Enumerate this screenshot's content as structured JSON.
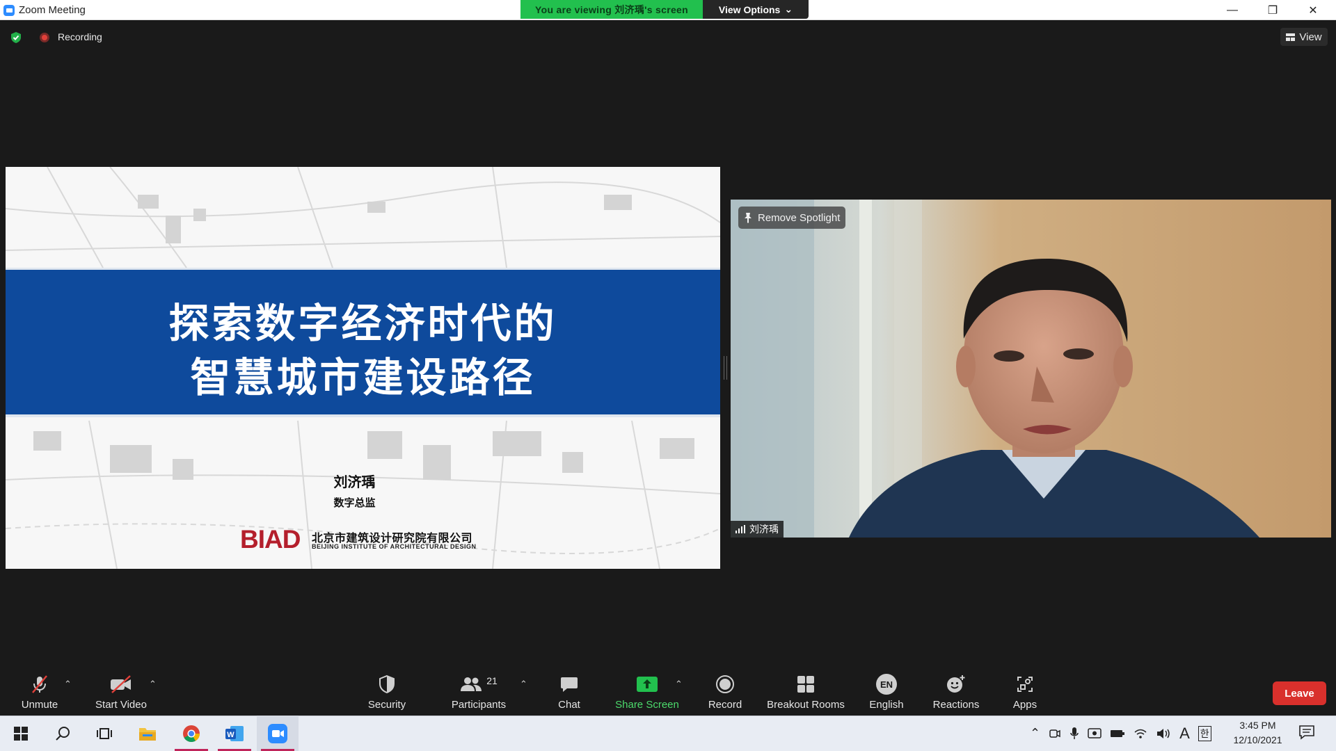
{
  "window": {
    "title": "Zoom Meeting",
    "viewing_banner": "You are viewing 刘济瑀's screen",
    "view_options": "View Options",
    "minimize": "—",
    "restore": "❐",
    "close": "✕"
  },
  "meeting_bar": {
    "recording": "Recording",
    "view": "View"
  },
  "shared_screen": {
    "title_line1": "探索数字经济时代的",
    "title_line2": "智慧城市建设路径",
    "presenter": "刘济瑀",
    "role": "数字总监",
    "logo": "BIAD",
    "org_cn": "北京市建筑设计研究院有限公司",
    "org_en": "BEIJING INSTITUTE OF ARCHITECTURAL DESIGN"
  },
  "video": {
    "remove_spotlight": "Remove Spotlight",
    "participant_name": "刘济瑀"
  },
  "toolbar": {
    "unmute": "Unmute",
    "start_video": "Start Video",
    "security": "Security",
    "participants": "Participants",
    "participants_count": "21",
    "chat": "Chat",
    "share_screen": "Share Screen",
    "record": "Record",
    "breakout_rooms": "Breakout Rooms",
    "language_code": "EN",
    "english": "English",
    "reactions": "Reactions",
    "apps": "Apps",
    "leave": "Leave"
  },
  "taskbar": {
    "time": "3:45 PM",
    "date": "12/10/2021",
    "ime": "A",
    "korean": "한"
  },
  "colors": {
    "zoom_blue": "#2d8cff",
    "banner_green": "#22c04e",
    "slide_blue": "#0e4a9c",
    "leave_red": "#d9302c",
    "share_green": "#4cdb6c"
  }
}
